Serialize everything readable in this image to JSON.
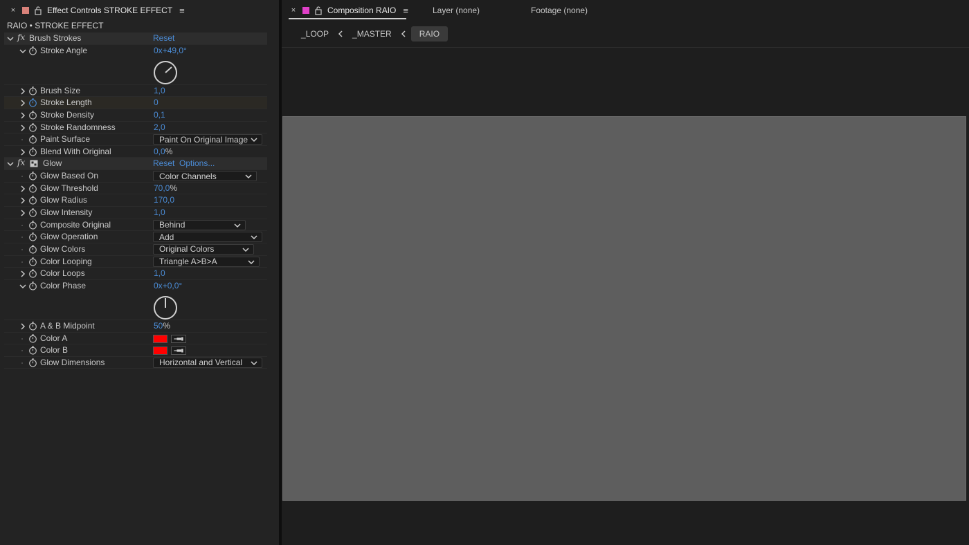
{
  "effect_controls": {
    "tab_title": "Effect Controls STROKE EFFECT",
    "close": "×",
    "menu": "≡",
    "swatch_color": "#d9827a",
    "header": "RAIO • STROKE EFFECT"
  },
  "brush": {
    "section": "Brush Strokes",
    "fx": "fx",
    "reset": "Reset",
    "stroke_angle": {
      "label": "Stroke Angle",
      "rev": "0x",
      "deg": "+49,0°"
    },
    "brush_size": {
      "label": "Brush Size",
      "value": "1,0"
    },
    "stroke_length": {
      "label": "Stroke Length",
      "value": "0"
    },
    "stroke_density": {
      "label": "Stroke Density",
      "value": "0,1"
    },
    "stroke_randomness": {
      "label": "Stroke Randomness",
      "value": "2,0"
    },
    "paint_surface": {
      "label": "Paint Surface",
      "value": "Paint On Original Image"
    },
    "blend": {
      "label": "Blend With Original",
      "value": "0,0",
      "unit": "%"
    }
  },
  "glow": {
    "section": "Glow",
    "fx": "fx",
    "reset": "Reset",
    "options": "Options...",
    "based_on": {
      "label": "Glow Based On",
      "value": "Color Channels"
    },
    "threshold": {
      "label": "Glow Threshold",
      "value": "70,0",
      "unit": "%"
    },
    "radius": {
      "label": "Glow Radius",
      "value": "170,0"
    },
    "intensity": {
      "label": "Glow Intensity",
      "value": "1,0"
    },
    "composite": {
      "label": "Composite Original",
      "value": "Behind"
    },
    "operation": {
      "label": "Glow Operation",
      "value": "Add"
    },
    "colors": {
      "label": "Glow Colors",
      "value": "Original Colors"
    },
    "looping": {
      "label": "Color Looping",
      "value": "Triangle A>B>A"
    },
    "loops": {
      "label": "Color Loops",
      "value": "1,0"
    },
    "phase": {
      "label": "Color Phase",
      "rev": "0x",
      "deg": "+0,0°"
    },
    "midpoint": {
      "label": "A & B Midpoint",
      "value": "50",
      "unit": "%"
    },
    "color_a": {
      "label": "Color A",
      "color": "#ff0000"
    },
    "color_b": {
      "label": "Color B",
      "color": "#ff0000"
    },
    "dimensions": {
      "label": "Glow Dimensions",
      "value": "Horizontal and Vertical"
    }
  },
  "composition": {
    "close": "×",
    "swatch_color": "#e040c8",
    "tab_title": "Composition RAIO",
    "menu": "≡",
    "layer_tab": "Layer (none)",
    "footage_tab": "Footage (none)",
    "breadcrumbs": [
      "_LOOP",
      "_MASTER",
      "RAIO"
    ]
  }
}
